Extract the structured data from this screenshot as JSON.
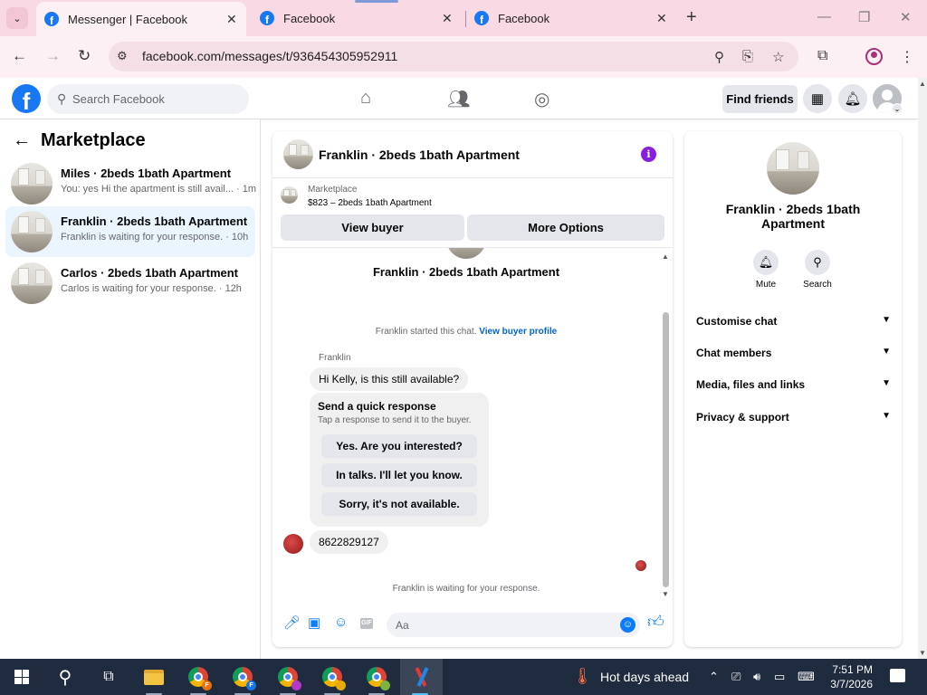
{
  "browser": {
    "tabs": [
      {
        "title": "Messenger | Facebook",
        "active": true
      },
      {
        "title": "Facebook",
        "active": false
      },
      {
        "title": "Facebook",
        "active": false
      }
    ],
    "url": "facebook.com/messages/t/936454305952911",
    "icons": [
      "tab-list-icon",
      "close-icon",
      "plus-icon",
      "minimize-icon",
      "restore-icon",
      "window-close-icon",
      "back-icon",
      "forward-icon",
      "reload-icon",
      "site-info-icon",
      "zoom-icon",
      "install-icon",
      "star-icon",
      "extensions-icon",
      "profile-icon",
      "menu-icon"
    ]
  },
  "fb_header": {
    "logo": "f",
    "search_placeholder": "Search Facebook",
    "find_friends": "Find friends"
  },
  "left_panel": {
    "title": "Marketplace",
    "conversations": [
      {
        "name": "Miles · 2beds 1bath Apartment",
        "preview": "You: yes Hi the apartment is still avail... · 1m"
      },
      {
        "name": "Franklin · 2beds 1bath Apartment",
        "preview": "Franklin is waiting for your response. · 10h",
        "active": true
      },
      {
        "name": "Carlos · 2beds 1bath Apartment",
        "preview": "Carlos is waiting for your response. · 12h"
      }
    ]
  },
  "chat": {
    "title": "Franklin · 2beds 1bath Apartment",
    "marketplace_label": "Marketplace",
    "listing": "$823 – 2beds 1bath Apartment",
    "view_buyer": "View buyer",
    "more_options": "More Options",
    "thread_name": "Franklin · 2beds 1bath Apartment",
    "started_text": "Franklin started this chat.",
    "buyer_profile_link": "View buyer profile",
    "sender": "Franklin",
    "first_message": "Hi Kelly, is this still available?",
    "quick_response": {
      "title": "Send a quick response",
      "subtitle": "Tap a response to send it to the buyer.",
      "options": [
        "Yes. Are you interested?",
        "In talks. I'll let you know.",
        "Sorry, it's not available."
      ]
    },
    "second_message": "8622829127",
    "waiting_text": "Franklin is waiting for your response.",
    "composer_placeholder": "Aa",
    "gif_label": "GIF"
  },
  "right_panel": {
    "name": "Franklin · 2beds 1bath Apartment",
    "actions": [
      {
        "label": "Mute",
        "icon": "bell-icon"
      },
      {
        "label": "Search",
        "icon": "search-icon"
      }
    ],
    "sections": [
      "Customise chat",
      "Chat members",
      "Media, files and links",
      "Privacy & support"
    ]
  },
  "taskbar": {
    "weather": "Hot days ahead",
    "time": "7:51 PM",
    "date": "3/7/2026",
    "chrome_badges": [
      "F",
      "F",
      "",
      "",
      ""
    ]
  },
  "colors": {
    "fb_blue": "#1877f2",
    "messenger_blue": "#0a7cff",
    "tab_bar": "#f9d9e4",
    "taskbar": "#1f2b3e",
    "info_purple": "#8a1ee0"
  }
}
